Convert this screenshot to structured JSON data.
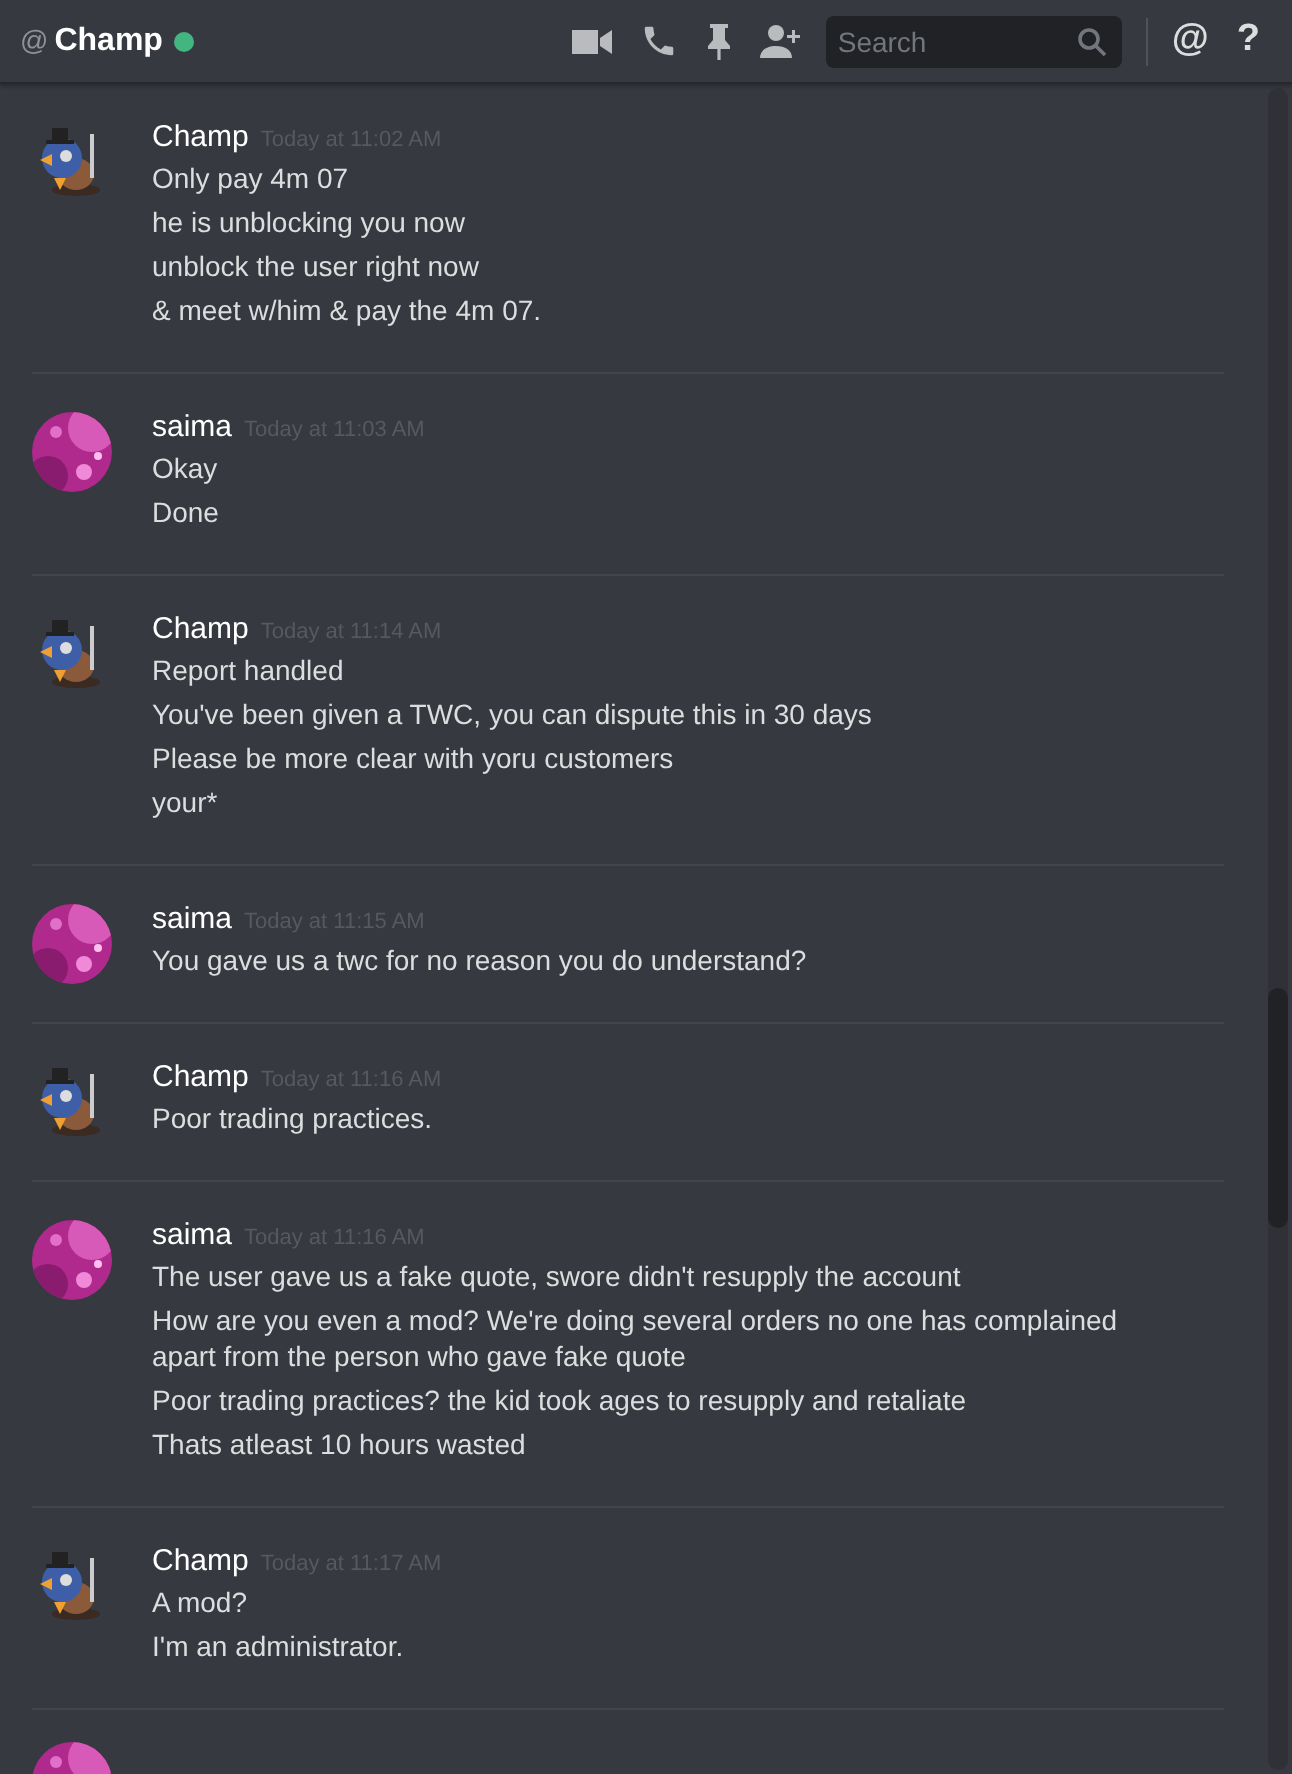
{
  "header": {
    "prefix": "@",
    "channel": "Champ",
    "online": true,
    "search": {
      "placeholder": "Search"
    },
    "mention_button": "@",
    "help_button": "?"
  },
  "messages": [
    {
      "author": "Champ",
      "kind": "bird",
      "timestamp": "Today at 11:02 AM",
      "lines": [
        "Only pay 4m 07",
        "he is unblocking you now",
        "unblock the user right now",
        "& meet w/him & pay the 4m 07."
      ]
    },
    {
      "author": "saima",
      "kind": "pink",
      "timestamp": "Today at 11:03 AM",
      "lines": [
        "Okay",
        "Done"
      ]
    },
    {
      "author": "Champ",
      "kind": "bird",
      "timestamp": "Today at 11:14 AM",
      "lines": [
        "Report handled",
        "You've been given a TWC, you can dispute this  in 30 days",
        "Please be more clear with yoru customers",
        "your*"
      ]
    },
    {
      "author": "saima",
      "kind": "pink",
      "timestamp": "Today at 11:15 AM",
      "lines": [
        "You gave us a twc for no reason you do understand?"
      ]
    },
    {
      "author": "Champ",
      "kind": "bird",
      "timestamp": "Today at 11:16 AM",
      "lines": [
        "Poor trading practices."
      ]
    },
    {
      "author": "saima",
      "kind": "pink",
      "timestamp": "Today at 11:16 AM",
      "lines": [
        "The user gave us a fake quote, swore didn't resupply the account",
        "How are you even a mod? We're doing several orders no one has complained apart from the person who gave fake quote",
        "Poor trading practices? the kid took ages to resupply and retaliate",
        "Thats atleast 10 hours wasted"
      ]
    },
    {
      "author": "Champ",
      "kind": "bird",
      "timestamp": "Today at 11:17 AM",
      "lines": [
        "A mod?",
        "I'm an administrator."
      ]
    }
  ],
  "cut_off_group": {
    "kind": "pink"
  }
}
